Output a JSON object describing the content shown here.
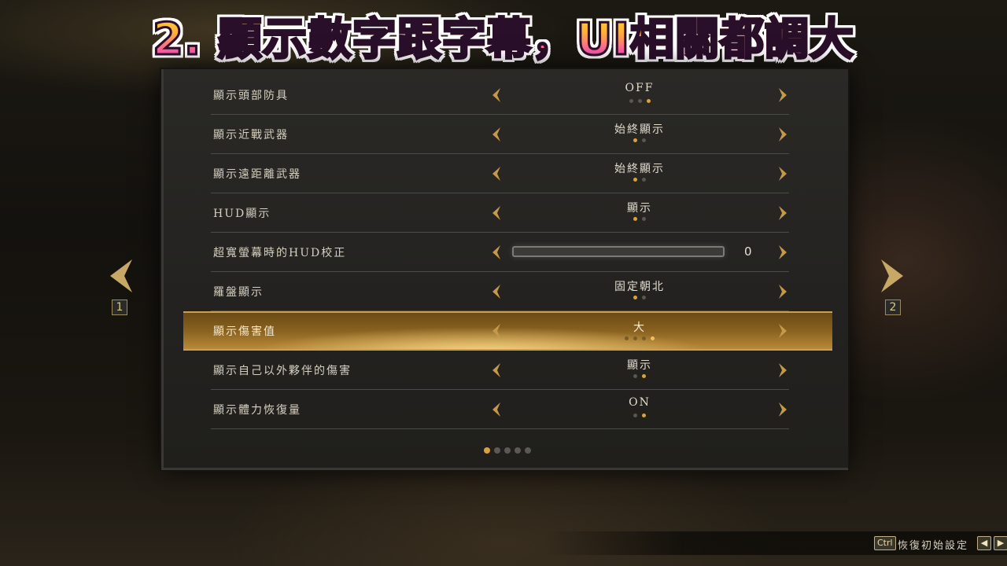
{
  "banner": {
    "title": "2. 顯示數字跟字幕，UI相關都調大"
  },
  "settings": {
    "rows": [
      {
        "label": "顯示頭部防具",
        "value": "OFF",
        "dots": 3,
        "active": 2
      },
      {
        "label": "顯示近戰武器",
        "value": "始終顯示",
        "dots": 2,
        "active": 0
      },
      {
        "label": "顯示遠距離武器",
        "value": "始終顯示",
        "dots": 2,
        "active": 0
      },
      {
        "label": "HUD顯示",
        "value": "顯示",
        "dots": 2,
        "active": 0
      },
      {
        "label": "超寬螢幕時的HUD校正",
        "slider": true,
        "value": "0",
        "slider_level": 0
      },
      {
        "label": "羅盤顯示",
        "value": "固定朝北",
        "dots": 2,
        "active": 0
      },
      {
        "label": "顯示傷害值",
        "value": "大",
        "dots": 4,
        "active": 3,
        "selected": true
      },
      {
        "label": "顯示自己以外夥伴的傷害",
        "value": "顯示",
        "dots": 2,
        "active": 1
      },
      {
        "label": "顯示體力恢復量",
        "value": "ON",
        "dots": 2,
        "active": 1
      }
    ]
  },
  "pagination": {
    "count": 5,
    "active": 0
  },
  "nav": {
    "prev_page": "1",
    "next_page": "2"
  },
  "footer": {
    "ctrl_key": "Ctrl",
    "reset_label": "恢復初始設定",
    "key_left": "◀",
    "key_right": "▶"
  },
  "colors": {
    "accent": "#d9a23e",
    "inactive": "#5a5650",
    "panel": "#262522"
  },
  "icons": {
    "left": "chevron-left-icon",
    "right": "chevron-right-icon"
  }
}
